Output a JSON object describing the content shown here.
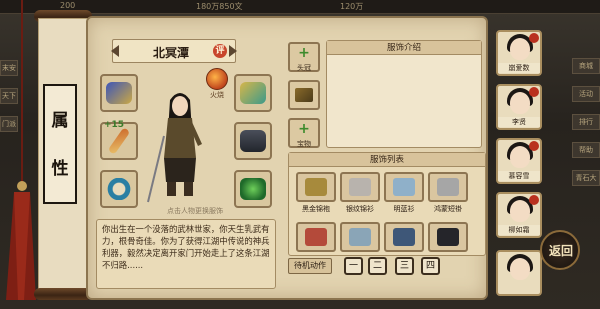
{
  "topbar": {
    "left_value": "200",
    "mid_value": "180万850文",
    "right_value": "120万"
  },
  "left_tabs": [
    "末安",
    "天下",
    "门派"
  ],
  "right_tabs": [
    "商城",
    "活动",
    "排行",
    "帮助",
    "青石大"
  ],
  "scroll": {
    "title_chars": [
      "属",
      "性"
    ]
  },
  "character": {
    "name": "北冥潭",
    "rating_badge": "评",
    "hint": "点击人物更换服饰",
    "description": "你出生在一个没落的武林世家，你天生乳武有力，根骨奇佳。你为了获得江湖中传说的神兵利器，毅然决定离开家门开始走上了这条江湖不归路......"
  },
  "fire_orb": {
    "label": "火烧"
  },
  "slot_badge": "+15",
  "equip_buttons": [
    {
      "symbol": "+",
      "label": "头冠",
      "color": "#3d8b2c"
    },
    {
      "symbol": "",
      "label": "",
      "color": "#3a2a1a"
    },
    {
      "symbol": "+",
      "label": "宝物",
      "color": "#3d8b2c"
    }
  ],
  "panels": {
    "intro_title": "服饰介绍",
    "list_title": "服饰列表"
  },
  "items": [
    {
      "label": "黑金锦袍",
      "color": "#a78a3c"
    },
    {
      "label": "银纹锦衫",
      "color": "#b8b3ad"
    },
    {
      "label": "明蓝衫",
      "color": "#8fb0c9"
    },
    {
      "label": "鸿蒙短褂",
      "color": "#a6a6a6"
    },
    {
      "label": "",
      "color": "#b44a3a"
    },
    {
      "label": "",
      "color": "#8aa5b7"
    },
    {
      "label": "",
      "color": "#3e5778"
    },
    {
      "label": "",
      "color": "#25252a"
    }
  ],
  "controls": {
    "idle_action": "待机动作",
    "pages": [
      "一",
      "二",
      "三",
      "四"
    ]
  },
  "portraits": [
    {
      "name": "崩爱数"
    },
    {
      "name": "李贤"
    },
    {
      "name": "慕容雪"
    },
    {
      "name": "柳如霜"
    },
    {
      "name": ""
    }
  ],
  "back_button": "返回",
  "colors": {
    "panel_bg": "#e2d3b0",
    "border": "#8b744f",
    "accent_red": "#b9311f"
  }
}
